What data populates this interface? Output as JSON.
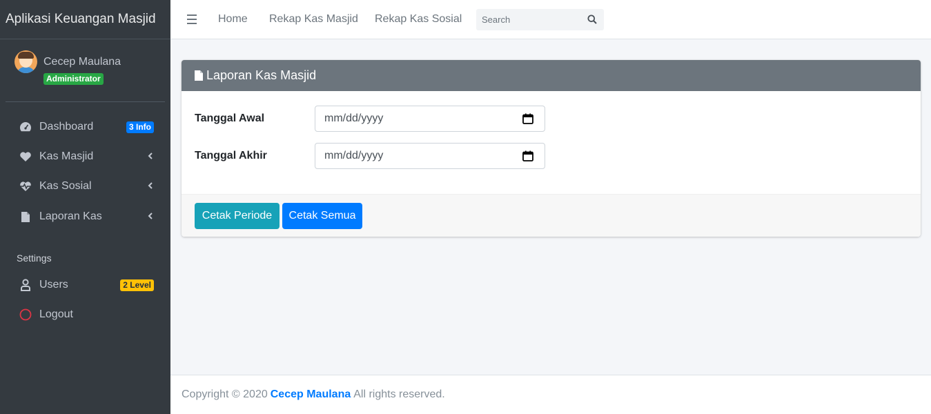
{
  "sidebar": {
    "brand": "Aplikasi Keuangan Masjid",
    "user": {
      "name": "Cecep Maulana",
      "role": "Administrator"
    },
    "items": [
      {
        "label": "Dashboard",
        "badge": "3 Info",
        "badge_color": "#007bff",
        "icon": "dashboard-icon"
      },
      {
        "label": "Kas Masjid",
        "icon": "heart-icon",
        "has_submenu": true
      },
      {
        "label": "Kas Sosial",
        "icon": "heartbeat-icon",
        "has_submenu": true
      },
      {
        "label": "Laporan Kas",
        "icon": "file-icon",
        "has_submenu": true
      }
    ],
    "settings_header": "Settings",
    "settings_items": [
      {
        "label": "Users",
        "badge": "2 Level",
        "badge_color": "#ffc107",
        "icon": "user-icon"
      },
      {
        "label": "Logout",
        "icon": "circle-icon",
        "icon_color": "#dc3545"
      }
    ]
  },
  "topbar": {
    "links": [
      "Home",
      "Rekap Kas Masjid",
      "Rekap Kas Sosial"
    ],
    "search": {
      "placeholder": "Search",
      "value": ""
    }
  },
  "card": {
    "title": "Laporan Kas Masjid",
    "header_color": "#6c757d",
    "fields": [
      {
        "label": "Tanggal Awal",
        "placeholder": "mm/dd/yyyy"
      },
      {
        "label": "Tanggal Akhir",
        "placeholder": "mm/dd/yyyy"
      }
    ],
    "buttons": [
      {
        "label": "Cetak Periode",
        "color": "#17a2b8"
      },
      {
        "label": "Cetak Semua",
        "color": "#007bff"
      }
    ]
  },
  "footer": {
    "prefix": "Copyright © 2020",
    "author": "Cecep Maulana",
    "suffix": "All rights reserved."
  }
}
